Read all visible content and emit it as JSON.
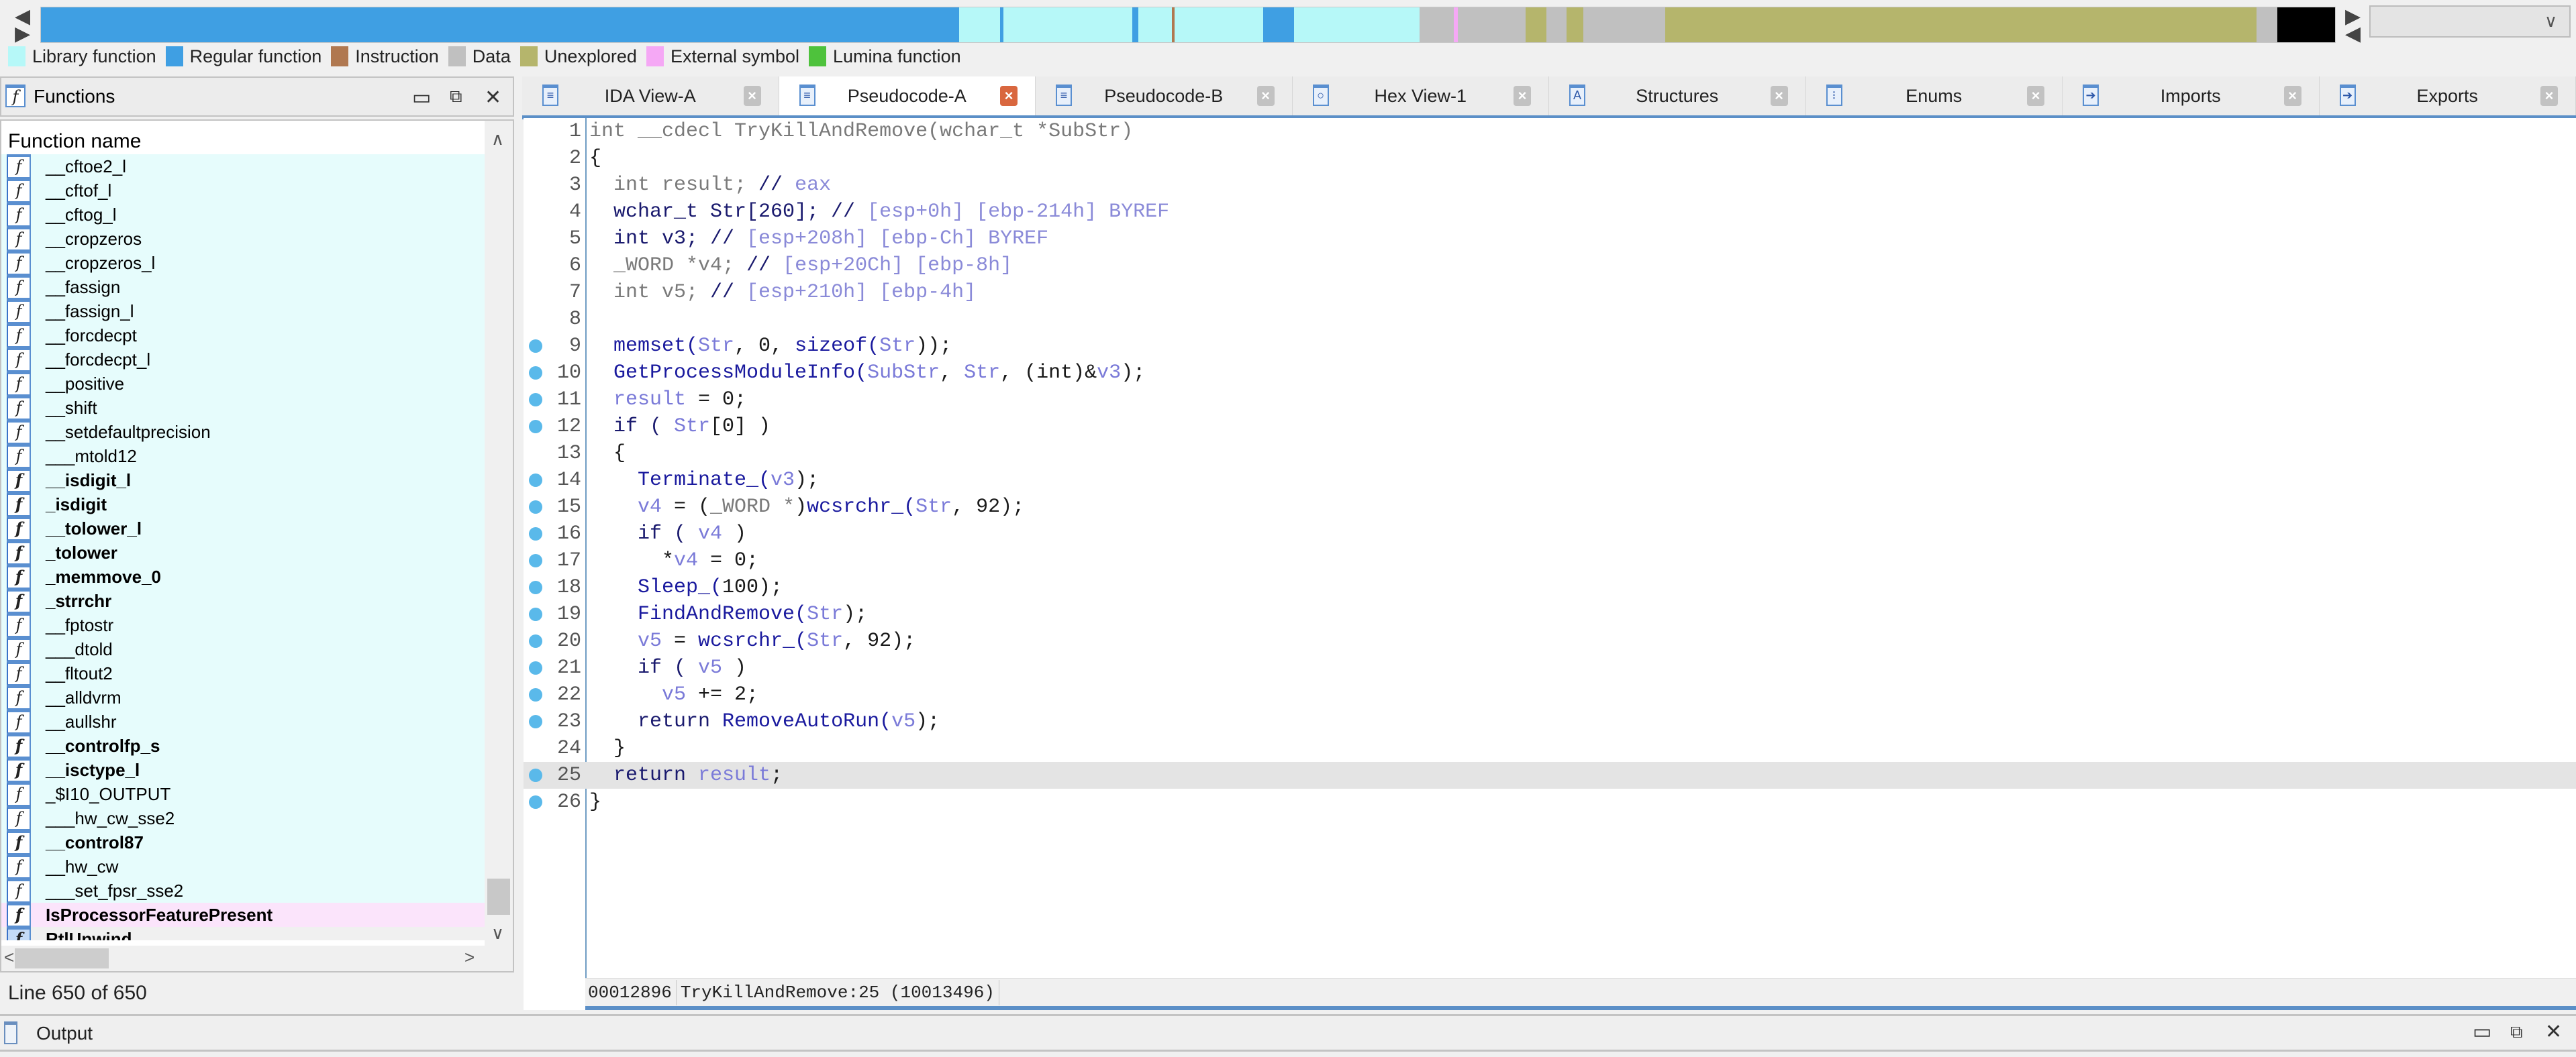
{
  "nav_band": {
    "segments": [
      {
        "kind": "regular",
        "color": "#3f9fe3",
        "weight": 1350
      },
      {
        "kind": "library",
        "color": "#b6f8f8",
        "weight": 60
      },
      {
        "kind": "regular",
        "color": "#3f9fe3",
        "weight": 5
      },
      {
        "kind": "library",
        "color": "#b6f8f8",
        "weight": 190
      },
      {
        "kind": "regular",
        "color": "#3f9fe3",
        "weight": 8
      },
      {
        "kind": "library",
        "color": "#b6f8f8",
        "weight": 50
      },
      {
        "kind": "instruction",
        "color": "#b07850",
        "weight": 4
      },
      {
        "kind": "library",
        "color": "#b6f8f8",
        "weight": 130
      },
      {
        "kind": "regular",
        "color": "#3f9fe3",
        "weight": 45
      },
      {
        "kind": "library",
        "color": "#b6f8f8",
        "weight": 185
      },
      {
        "kind": "data",
        "color": "#c0c0c0",
        "weight": 50
      },
      {
        "kind": "external",
        "color": "#f5a8f5",
        "weight": 6
      },
      {
        "kind": "data",
        "color": "#c0c0c0",
        "weight": 100
      },
      {
        "kind": "unexplored",
        "color": "#b5b56c",
        "weight": 30
      },
      {
        "kind": "data",
        "color": "#c0c0c0",
        "weight": 30
      },
      {
        "kind": "unexplored",
        "color": "#b5b56c",
        "weight": 25
      },
      {
        "kind": "data",
        "color": "#c0c0c0",
        "weight": 120
      },
      {
        "kind": "unexplored",
        "color": "#b5b56c",
        "weight": 870
      },
      {
        "kind": "data",
        "color": "#c0c0c0",
        "weight": 30
      },
      {
        "kind": "black",
        "color": "#000000",
        "weight": 85
      }
    ],
    "dropdown_value": ""
  },
  "legend": [
    {
      "label": "Library function",
      "color": "#b6f8f8"
    },
    {
      "label": "Regular function",
      "color": "#3f9fe3"
    },
    {
      "label": "Instruction",
      "color": "#b07850"
    },
    {
      "label": "Data",
      "color": "#c0c0c0"
    },
    {
      "label": "Unexplored",
      "color": "#b5b56c"
    },
    {
      "label": "External symbol",
      "color": "#f5a8f5"
    },
    {
      "label": "Lumina function",
      "color": "#4ec23c"
    }
  ],
  "functions_panel": {
    "title": "Functions",
    "column_header": "Function name",
    "rows": [
      {
        "name": "__cftoe2_l",
        "style": "normal"
      },
      {
        "name": "__cftof_l",
        "style": "normal"
      },
      {
        "name": "__cftog_l",
        "style": "normal"
      },
      {
        "name": "__cropzeros",
        "style": "normal"
      },
      {
        "name": "__cropzeros_l",
        "style": "normal"
      },
      {
        "name": "__fassign",
        "style": "normal"
      },
      {
        "name": "__fassign_l",
        "style": "normal"
      },
      {
        "name": "__forcdecpt",
        "style": "normal"
      },
      {
        "name": "__forcdecpt_l",
        "style": "normal"
      },
      {
        "name": "__positive",
        "style": "normal"
      },
      {
        "name": "__shift",
        "style": "normal"
      },
      {
        "name": "__setdefaultprecision",
        "style": "normal"
      },
      {
        "name": "___mtold12",
        "style": "normal"
      },
      {
        "name": "__isdigit_l",
        "style": "bold"
      },
      {
        "name": "_isdigit",
        "style": "bold"
      },
      {
        "name": "__tolower_l",
        "style": "bold"
      },
      {
        "name": "_tolower",
        "style": "bold"
      },
      {
        "name": "_memmove_0",
        "style": "bold"
      },
      {
        "name": "_strrchr",
        "style": "bold"
      },
      {
        "name": "__fptostr",
        "style": "normal"
      },
      {
        "name": "___dtold",
        "style": "normal"
      },
      {
        "name": "__fltout2",
        "style": "normal"
      },
      {
        "name": "__alldvrm",
        "style": "normal"
      },
      {
        "name": "__aullshr",
        "style": "normal"
      },
      {
        "name": "__controlfp_s",
        "style": "bold"
      },
      {
        "name": "__isctype_l",
        "style": "bold"
      },
      {
        "name": "_$I10_OUTPUT",
        "style": "normal"
      },
      {
        "name": "___hw_cw_sse2",
        "style": "normal"
      },
      {
        "name": "__control87",
        "style": "bold"
      },
      {
        "name": "__hw_cw",
        "style": "normal"
      },
      {
        "name": "___set_fpsr_sse2",
        "style": "normal"
      },
      {
        "name": "IsProcessorFeaturePresent",
        "style": "bold-external"
      },
      {
        "name": "RtlUnwind",
        "style": "bold-selected"
      }
    ],
    "line_status": "Line 650 of 650"
  },
  "tabs": [
    {
      "label": "IDA View-A",
      "icon": "disassembly-icon",
      "active": false
    },
    {
      "label": "Pseudocode-A",
      "icon": "pseudocode-icon",
      "active": true
    },
    {
      "label": "Pseudocode-B",
      "icon": "pseudocode-icon",
      "active": false
    },
    {
      "label": "Hex View-1",
      "icon": "hex-view-icon",
      "active": false
    },
    {
      "label": "Structures",
      "icon": "structures-icon",
      "active": false
    },
    {
      "label": "Enums",
      "icon": "enums-icon",
      "active": false
    },
    {
      "label": "Imports",
      "icon": "imports-icon",
      "active": false
    },
    {
      "label": "Exports",
      "icon": "exports-icon",
      "active": false
    }
  ],
  "code": {
    "lines": [
      {
        "n": "1",
        "bp": false,
        "tokens": [
          [
            "gr",
            "int __cdecl TryKillAndRemove(wchar_t *SubStr)"
          ]
        ]
      },
      {
        "n": "2",
        "bp": false,
        "tokens": [
          [
            "pl",
            "{"
          ]
        ]
      },
      {
        "n": "3",
        "bp": false,
        "tokens": [
          [
            "gr",
            "  int result; "
          ],
          [
            "kw",
            "// "
          ],
          [
            "cm",
            "eax"
          ]
        ]
      },
      {
        "n": "4",
        "bp": false,
        "tokens": [
          [
            "kw",
            "  wchar_t Str[260]; // "
          ],
          [
            "cm",
            "[esp+0h] [ebp-214h] BYREF"
          ]
        ]
      },
      {
        "n": "5",
        "bp": false,
        "tokens": [
          [
            "kw",
            "  int v3; // "
          ],
          [
            "cm",
            "[esp+208h] [ebp-Ch] BYREF"
          ]
        ]
      },
      {
        "n": "6",
        "bp": false,
        "tokens": [
          [
            "gr",
            "  _WORD *v4; "
          ],
          [
            "kw",
            "// "
          ],
          [
            "cm",
            "[esp+20Ch] [ebp-8h]"
          ]
        ]
      },
      {
        "n": "7",
        "bp": false,
        "tokens": [
          [
            "gr",
            "  int v5; "
          ],
          [
            "kw",
            "// "
          ],
          [
            "cm",
            "[esp+210h] [ebp-4h]"
          ]
        ]
      },
      {
        "n": "8",
        "bp": false,
        "tokens": [
          [
            "pl",
            ""
          ]
        ]
      },
      {
        "n": "9",
        "bp": true,
        "tokens": [
          [
            "fn",
            "  memset("
          ],
          [
            "var",
            "Str"
          ],
          [
            "pl",
            ", 0, "
          ],
          [
            "fn",
            "sizeof("
          ],
          [
            "var",
            "Str"
          ],
          [
            "pl",
            "));"
          ]
        ]
      },
      {
        "n": "10",
        "bp": true,
        "tokens": [
          [
            "fn",
            "  GetProcessModuleInfo("
          ],
          [
            "var",
            "SubStr"
          ],
          [
            "pl",
            ", "
          ],
          [
            "var",
            "Str"
          ],
          [
            "pl",
            ", (int)&"
          ],
          [
            "var",
            "v3"
          ],
          [
            "pl",
            ");"
          ]
        ]
      },
      {
        "n": "11",
        "bp": true,
        "tokens": [
          [
            "var",
            "  result"
          ],
          [
            "pl",
            " = 0;"
          ]
        ]
      },
      {
        "n": "12",
        "bp": true,
        "tokens": [
          [
            "kw",
            "  if ( "
          ],
          [
            "var",
            "Str"
          ],
          [
            "pl",
            "[0] )"
          ]
        ]
      },
      {
        "n": "13",
        "bp": false,
        "tokens": [
          [
            "pl",
            "  {"
          ]
        ]
      },
      {
        "n": "14",
        "bp": true,
        "tokens": [
          [
            "fn",
            "    Terminate_("
          ],
          [
            "var",
            "v3"
          ],
          [
            "pl",
            ");"
          ]
        ]
      },
      {
        "n": "15",
        "bp": true,
        "tokens": [
          [
            "var",
            "    v4"
          ],
          [
            "pl",
            " = ("
          ],
          [
            "gr",
            "_WORD *"
          ],
          [
            "pl",
            ")"
          ],
          [
            "fn",
            "wcsrchr_("
          ],
          [
            "var",
            "Str"
          ],
          [
            "pl",
            ", 92);"
          ]
        ]
      },
      {
        "n": "16",
        "bp": true,
        "tokens": [
          [
            "kw",
            "    if ( "
          ],
          [
            "var",
            "v4"
          ],
          [
            "pl",
            " )"
          ]
        ]
      },
      {
        "n": "17",
        "bp": true,
        "tokens": [
          [
            "pl",
            "      *"
          ],
          [
            "var",
            "v4"
          ],
          [
            "pl",
            " = 0;"
          ]
        ]
      },
      {
        "n": "18",
        "bp": true,
        "tokens": [
          [
            "fn",
            "    Sleep_("
          ],
          [
            "pl",
            "100);"
          ]
        ]
      },
      {
        "n": "19",
        "bp": true,
        "tokens": [
          [
            "fn",
            "    FindAndRemove("
          ],
          [
            "var",
            "Str"
          ],
          [
            "pl",
            ");"
          ]
        ]
      },
      {
        "n": "20",
        "bp": true,
        "tokens": [
          [
            "var",
            "    v5"
          ],
          [
            "pl",
            " = "
          ],
          [
            "fn",
            "wcsrchr_("
          ],
          [
            "var",
            "Str"
          ],
          [
            "pl",
            ", 92);"
          ]
        ]
      },
      {
        "n": "21",
        "bp": true,
        "tokens": [
          [
            "kw",
            "    if ( "
          ],
          [
            "var",
            "v5"
          ],
          [
            "pl",
            " )"
          ]
        ]
      },
      {
        "n": "22",
        "bp": true,
        "tokens": [
          [
            "var",
            "      v5"
          ],
          [
            "pl",
            " += 2;"
          ]
        ]
      },
      {
        "n": "23",
        "bp": true,
        "tokens": [
          [
            "kw",
            "    return "
          ],
          [
            "fn",
            "RemoveAutoRun("
          ],
          [
            "var",
            "v5"
          ],
          [
            "pl",
            ");"
          ]
        ]
      },
      {
        "n": "24",
        "bp": false,
        "tokens": [
          [
            "pl",
            "  }"
          ]
        ]
      },
      {
        "n": "25",
        "bp": true,
        "hl": true,
        "tokens": [
          [
            "kw",
            "  return "
          ],
          [
            "var",
            "result"
          ],
          [
            "pl",
            ";"
          ]
        ]
      },
      {
        "n": "26",
        "bp": true,
        "tokens": [
          [
            "pl",
            "}"
          ]
        ]
      }
    ]
  },
  "status_bar": {
    "offset": "00012896",
    "location": "TryKillAndRemove:25 (10013496)"
  },
  "output_panel": {
    "title": "Output"
  }
}
